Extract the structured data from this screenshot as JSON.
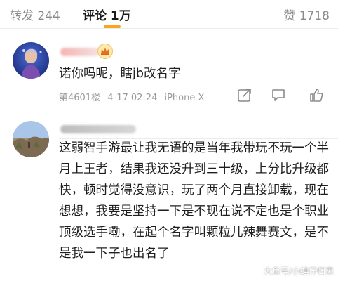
{
  "tabs": {
    "repost": "转发 244",
    "comment": "评论 1万",
    "like": "赞 1718"
  },
  "colors": {
    "accent": "#f6a623",
    "text": "#1e1e1e",
    "meta": "#9a9a9a"
  },
  "comments": [
    {
      "text": "诺你吗呢，瞎jb改名字",
      "meta": {
        "floor": "第4601楼",
        "time": "4-17 02:24",
        "device": "iPhone X"
      },
      "icons": [
        "share-icon",
        "reply-icon",
        "like-icon"
      ]
    },
    {
      "text": "这弱智手游最让我无语的是当年我带玩不玩一个半月上王者，结果我还没升到三十级，上分比升级都快，顿时觉得没意识，玩了两个月直接卸载，现在想想，我要是坚持一下是不现在说不定也是个职业顶级选手嘞，在起个名字叫颗粒儿辣舞赛文，是不是我一下子也出名了"
    }
  ],
  "watermark": "大鱼号/小蛙仔归来"
}
